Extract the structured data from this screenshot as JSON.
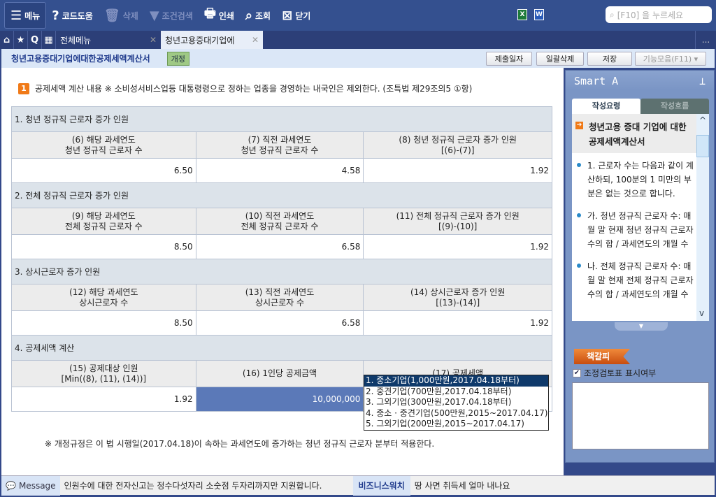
{
  "toolbar": {
    "menu": "메뉴",
    "help": "코드도움",
    "delete": "삭제",
    "filter": "조건검색",
    "print": "인쇄",
    "view": "조회",
    "close": "닫기",
    "search_placeholder": "[F10] 을 누르세요",
    "excel": "X",
    "word": "W"
  },
  "tabs": {
    "all_menu": "전체메뉴",
    "active": "청년고용증대기업에",
    "more": "..."
  },
  "titlebar": {
    "title": "청년고용증대기업에대한공제세액계산서",
    "badge": "개정",
    "buttons": [
      "제출일자",
      "일괄삭제",
      "저장",
      "기능모음(F11) ▾"
    ]
  },
  "note": {
    "num": "1",
    "text": "공제세액 계산 내용  ※ 소비성서비스업등 대통령령으로 정하는 업종을 경영하는 내국인은 제외한다. (조특법 제29조의5 ①항)"
  },
  "sections": [
    {
      "title": "1. 청년 정규직 근로자 증가 인원",
      "headers": [
        [
          "(6) 해당 과세연도",
          "청년 정규직 근로자 수"
        ],
        [
          "(7) 직전 과세연도",
          "청년 정규직 근로자 수"
        ],
        [
          "(8) 청년 정규직 근로자 증가 인원",
          "[(6)-(7)]"
        ]
      ],
      "values": [
        "6.50",
        "4.58",
        "1.92"
      ]
    },
    {
      "title": "2. 전체 정규직 근로자 증가 인원",
      "headers": [
        [
          "(9) 해당 과세연도",
          "전체 정규직 근로자 수"
        ],
        [
          "(10) 직전 과세연도",
          "전체 정규직 근로자 수"
        ],
        [
          "(11) 전체 정규직 근로자 증가 인원",
          "[(9)-(10)]"
        ]
      ],
      "values": [
        "8.50",
        "6.58",
        "1.92"
      ]
    },
    {
      "title": "3. 상시근로자 증가 인원",
      "headers": [
        [
          "(12) 해당 과세연도",
          "상시근로자 수"
        ],
        [
          "(13) 직전 과세연도",
          "상시근로자 수"
        ],
        [
          "(14) 상시근로자 증가 인원",
          "[(13)-(14)]"
        ]
      ],
      "values": [
        "8.50",
        "6.58",
        "1.92"
      ]
    },
    {
      "title": "4. 공제세액 계산",
      "headers": [
        [
          "(15) 공제대상 인원",
          "[Min((8), (11), (14))]"
        ],
        [
          "(16) 1인당 공제금액",
          ""
        ],
        [
          "(17) 공제세액",
          ""
        ]
      ],
      "values": [
        "1.92",
        "10,000,000",
        ""
      ]
    }
  ],
  "dropdown": [
    "1. 중소기업(1,000만원,2017.04.18부터)",
    "2. 중견기업(700만원,2017.04.18부터)",
    "3. 그외기업(300만원,2017.04.18부터)",
    "4. 중소 · 중견기업(500만원,2015~2017.04.17)",
    "5. 그외기업(200만원,2015~2017.04.17)"
  ],
  "footnote": "※ 개정규정은 이 법 시행일(2017.04.18)이 속하는 과세연도에 증가하는 청년 정규직 근로자 분부터 적용한다.",
  "side": {
    "title": "Smart A",
    "tab1": "작성요령",
    "tab2": "작성흐름",
    "heading": "청년고용 증대 기업에 대한 공제세액계산서",
    "items": [
      "1. 근로자 수는 다음과 같이 계산하되, 100분의 1 미만의 부분은 없는 것으로 합니다.",
      "가. 청년 정규직 근로자 수: 매월 말 현재 청년 정규직 근로자 수의 합 / 과세연도의 개월 수",
      "나. 전체 정규직 근로자 수: 매월 말 현재 전체 정규직 근로자 수의 합 / 과세연도의 개월 수"
    ],
    "bookmark": "책갈피",
    "checkbox": "조정검토표 표시여부"
  },
  "status": {
    "message_label": "Message",
    "message": "인원수에 대한 전자신고는 정수다섯자리 소숫점 두자리까지만 지원합니다.",
    "biz_label": "비즈니스워치",
    "biz_text": "땅 사면 취득세 얼마 내나요"
  }
}
